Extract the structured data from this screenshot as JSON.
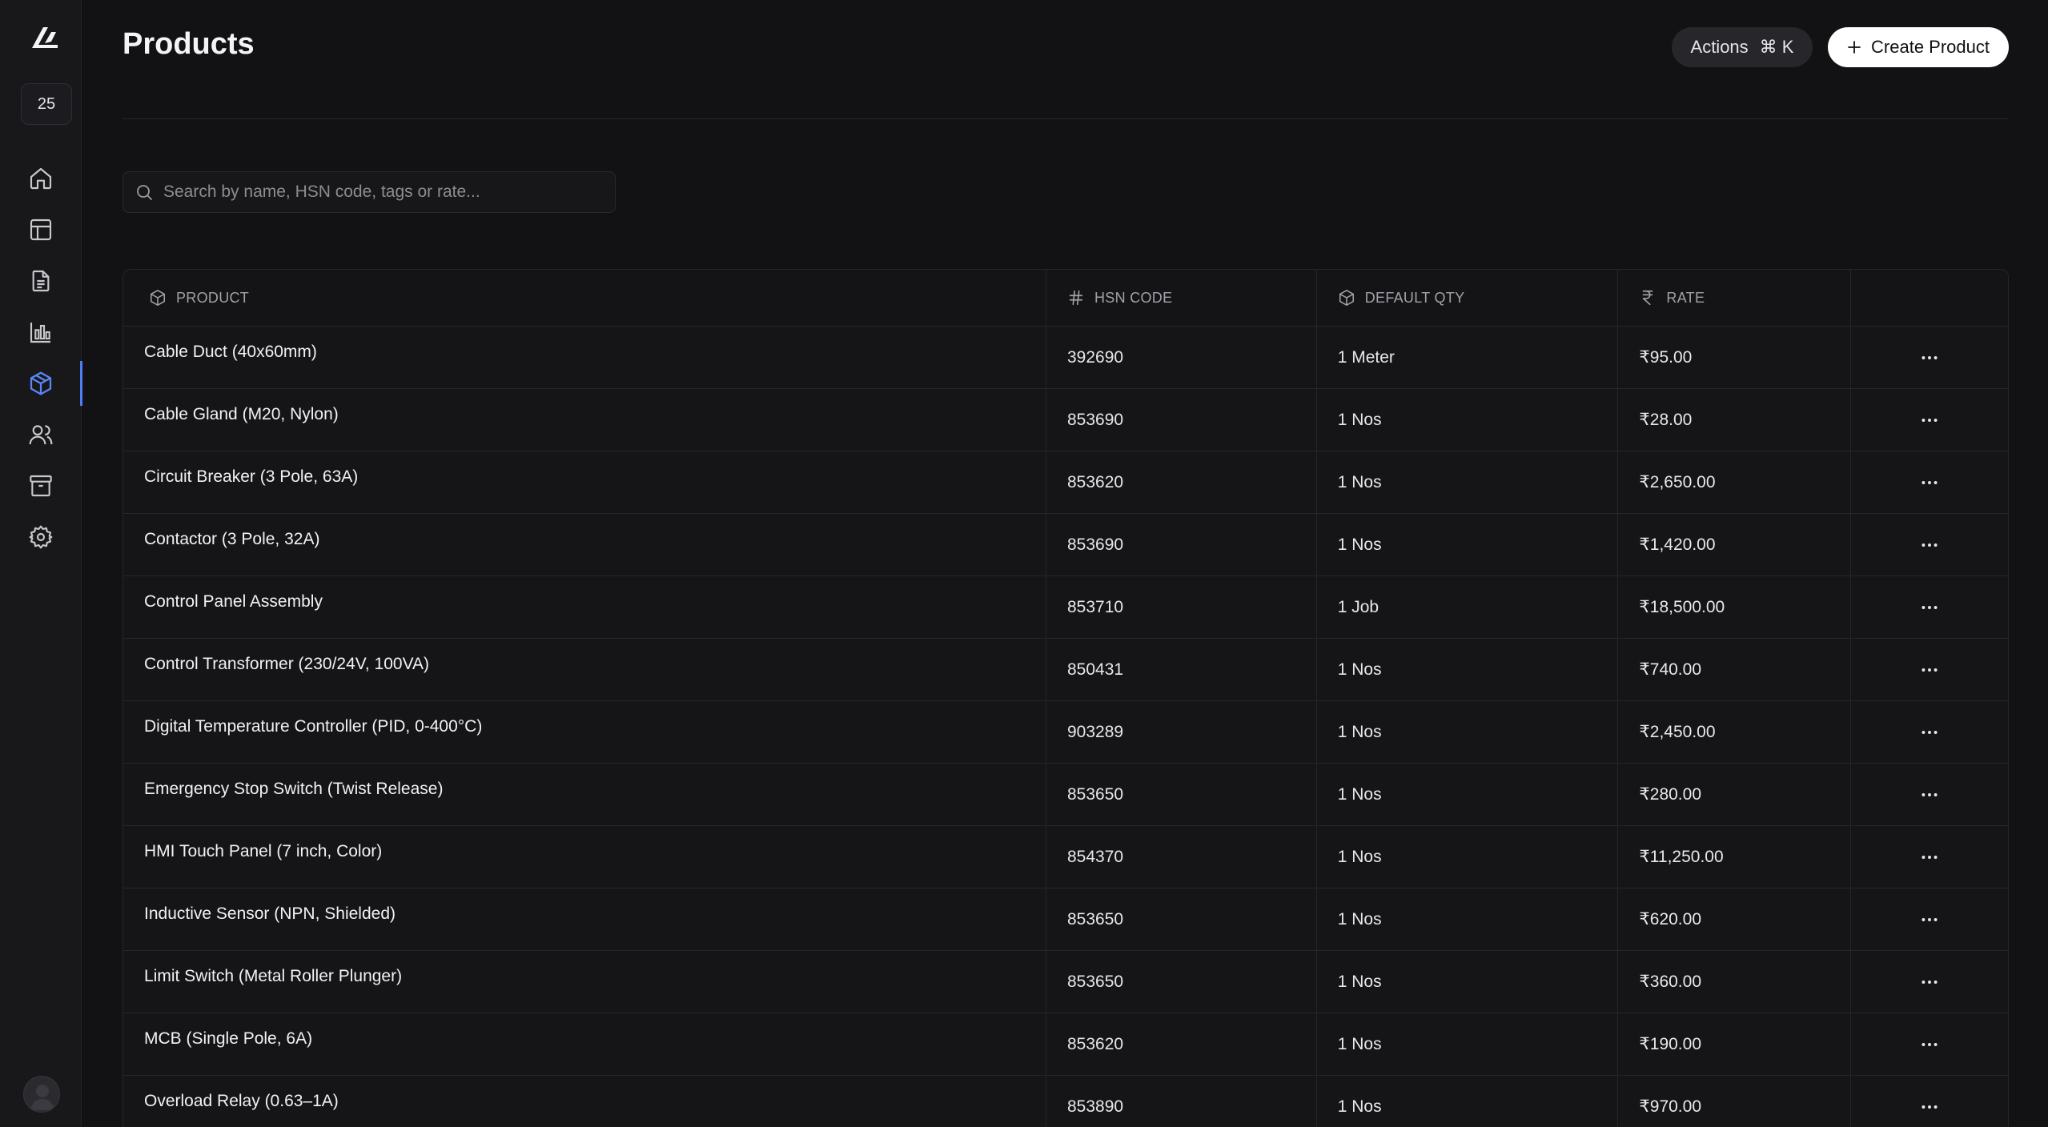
{
  "sidebar": {
    "badge": "25",
    "items": [
      {
        "icon": "home-icon"
      },
      {
        "icon": "table-icon"
      },
      {
        "icon": "document-icon"
      },
      {
        "icon": "bar-chart-icon"
      },
      {
        "icon": "package-icon",
        "active": true
      },
      {
        "icon": "users-icon"
      },
      {
        "icon": "archive-icon"
      },
      {
        "icon": "settings-icon"
      }
    ],
    "accent": "#4f7df5"
  },
  "header": {
    "title": "Products",
    "actions_label": "Actions",
    "actions_shortcut": "⌘ K",
    "create_label": "Create Product"
  },
  "search": {
    "placeholder": "Search by name, HSN code, tags or rate..."
  },
  "table": {
    "columns": [
      "PRODUCT",
      "HSN CODE",
      "DEFAULT QTY",
      "RATE"
    ],
    "rows": [
      {
        "name": "Cable Duct (40x60mm)",
        "hsn": "392690",
        "qty": "1 Meter",
        "rate": "₹95.00"
      },
      {
        "name": "Cable Gland (M20, Nylon)",
        "hsn": "853690",
        "qty": "1 Nos",
        "rate": "₹28.00"
      },
      {
        "name": "Circuit Breaker (3 Pole, 63A)",
        "hsn": "853620",
        "qty": "1 Nos",
        "rate": "₹2,650.00"
      },
      {
        "name": "Contactor (3 Pole, 32A)",
        "hsn": "853690",
        "qty": "1 Nos",
        "rate": "₹1,420.00"
      },
      {
        "name": "Control Panel Assembly",
        "hsn": "853710",
        "qty": "1 Job",
        "rate": "₹18,500.00"
      },
      {
        "name": "Control Transformer (230/24V, 100VA)",
        "hsn": "850431",
        "qty": "1 Nos",
        "rate": "₹740.00"
      },
      {
        "name": "Digital Temperature Controller (PID, 0-400°C)",
        "hsn": "903289",
        "qty": "1 Nos",
        "rate": "₹2,450.00"
      },
      {
        "name": "Emergency Stop Switch (Twist Release)",
        "hsn": "853650",
        "qty": "1 Nos",
        "rate": "₹280.00"
      },
      {
        "name": "HMI Touch Panel (7 inch, Color)",
        "hsn": "854370",
        "qty": "1 Nos",
        "rate": "₹11,250.00"
      },
      {
        "name": "Inductive Sensor (NPN, Shielded)",
        "hsn": "853650",
        "qty": "1 Nos",
        "rate": "₹620.00"
      },
      {
        "name": "Limit Switch (Metal Roller Plunger)",
        "hsn": "853650",
        "qty": "1 Nos",
        "rate": "₹360.00"
      },
      {
        "name": "MCB (Single Pole, 6A)",
        "hsn": "853620",
        "qty": "1 Nos",
        "rate": "₹190.00"
      },
      {
        "name": "Overload Relay (0.63–1A)",
        "hsn": "853890",
        "qty": "1 Nos",
        "rate": "₹970.00"
      }
    ]
  }
}
